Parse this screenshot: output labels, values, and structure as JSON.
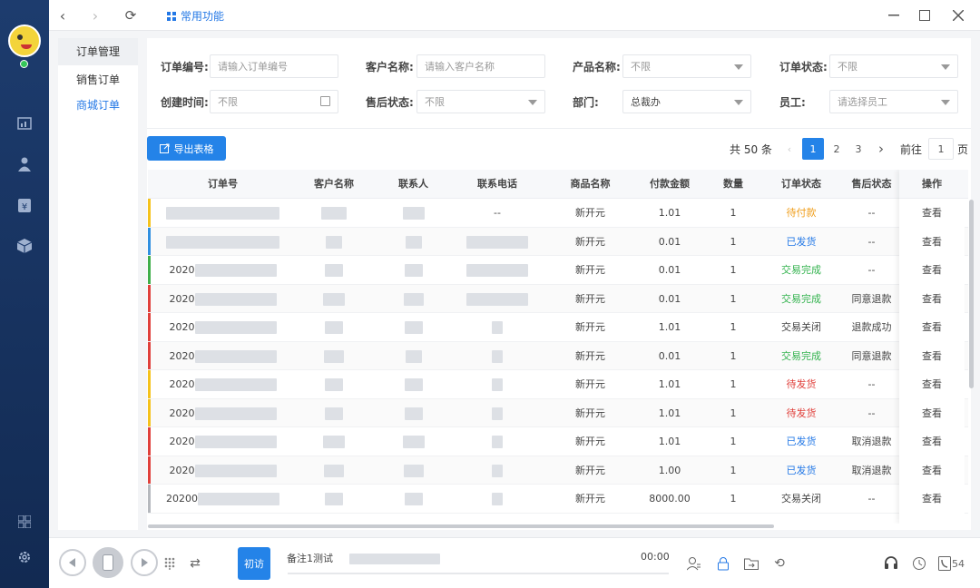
{
  "topbar": {
    "title": "常用功能"
  },
  "subnav": {
    "group": "订单管理",
    "items": [
      "销售订单",
      "商城订单"
    ]
  },
  "filters": {
    "order_no": {
      "label": "订单编号:",
      "placeholder": "请输入订单编号"
    },
    "customer": {
      "label": "客户名称:",
      "placeholder": "请输入客户名称"
    },
    "product": {
      "label": "产品名称:",
      "value": "不限"
    },
    "order_status": {
      "label": "订单状态:",
      "value": "不限"
    },
    "created": {
      "label": "创建时间:",
      "value": "不限"
    },
    "after_sale": {
      "label": "售后状态:",
      "value": "不限"
    },
    "department": {
      "label": "部门:",
      "value": "总裁办"
    },
    "employee": {
      "label": "员工:",
      "value": "请选择员工"
    }
  },
  "export_label": "导出表格",
  "pagination": {
    "total": "共 50 条",
    "pages": [
      "1",
      "2",
      "3"
    ],
    "goto_prefix": "前往",
    "goto_value": "1",
    "goto_suffix": "页"
  },
  "table": {
    "headers": [
      "订单号",
      "客户名称",
      "联系人",
      "联系电话",
      "商品名称",
      "付款金额",
      "数量",
      "订单状态",
      "售后状态",
      "操作"
    ],
    "rows": [
      {
        "order_no": "",
        "product": "新开元",
        "amount": "1.01",
        "qty": "1",
        "status": "待付款",
        "status_color": "yellow",
        "after": "--",
        "op": "查看",
        "bar": "#f5c21b",
        "phone": "--"
      },
      {
        "order_no": "",
        "product": "新开元",
        "amount": "0.01",
        "qty": "1",
        "status": "已发货",
        "status_color": "blue",
        "after": "--",
        "op": "查看",
        "bar": "#2f8fe0",
        "phone": ""
      },
      {
        "order_no": "2020",
        "product": "新开元",
        "amount": "0.01",
        "qty": "1",
        "status": "交易完成",
        "status_color": "green",
        "after": "--",
        "op": "查看",
        "bar": "#3fae4a",
        "phone": ""
      },
      {
        "order_no": "2020",
        "product": "新开元",
        "amount": "0.01",
        "qty": "1",
        "status": "交易完成",
        "status_color": "green",
        "after": "同意退款",
        "op": "查看",
        "bar": "#e0403b",
        "phone": ""
      },
      {
        "order_no": "2020",
        "product": "新开元",
        "amount": "1.01",
        "qty": "1",
        "status": "交易关闭",
        "status_color": "gray",
        "after": "退款成功",
        "op": "查看",
        "bar": "#e0403b",
        "phone": ""
      },
      {
        "order_no": "2020",
        "product": "新开元",
        "amount": "0.01",
        "qty": "1",
        "status": "交易完成",
        "status_color": "green",
        "after": "同意退款",
        "op": "查看",
        "bar": "#e0403b",
        "phone": ""
      },
      {
        "order_no": "2020",
        "product": "新开元",
        "amount": "1.01",
        "qty": "1",
        "status": "待发货",
        "status_color": "red",
        "after": "--",
        "op": "查看",
        "bar": "#f5c21b",
        "phone": ""
      },
      {
        "order_no": "2020",
        "product": "新开元",
        "amount": "1.01",
        "qty": "1",
        "status": "待发货",
        "status_color": "red",
        "after": "--",
        "op": "查看",
        "bar": "#f5c21b",
        "phone": ""
      },
      {
        "order_no": "2020",
        "product": "新开元",
        "amount": "1.01",
        "qty": "1",
        "status": "已发货",
        "status_color": "blue",
        "after": "取消退款",
        "op": "查看",
        "bar": "#e0403b",
        "phone": ""
      },
      {
        "order_no": "2020",
        "product": "新开元",
        "amount": "1.00",
        "qty": "1",
        "status": "已发货",
        "status_color": "blue",
        "after": "取消退款",
        "op": "查看",
        "bar": "#e0403b",
        "phone": ""
      },
      {
        "order_no": "20200",
        "product": "新开元",
        "amount": "8000.00",
        "qty": "1",
        "status": "交易关闭",
        "status_color": "gray",
        "after": "--",
        "op": "查看",
        "bar": "#b5b8bd",
        "phone": ""
      }
    ]
  },
  "bottombar": {
    "visit_label": "初访",
    "note": "备注1测试",
    "time": "00:00",
    "count": "54"
  }
}
